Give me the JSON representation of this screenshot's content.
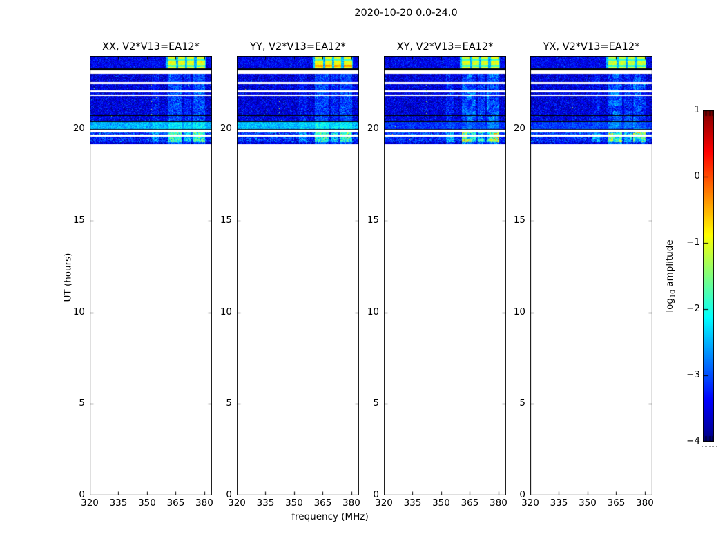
{
  "figure": {
    "title": "2020-10-20 0.0-24.0"
  },
  "colorbar": {
    "label_log": "log",
    "label_sub": "10",
    "label_rest": " amplitude",
    "vmin": -4,
    "vmax": 1,
    "ticks": [
      {
        "value": 1,
        "label": "1"
      },
      {
        "value": 0,
        "label": "0"
      },
      {
        "value": -1,
        "label": "−1"
      },
      {
        "value": -2,
        "label": "−2"
      },
      {
        "value": -3,
        "label": "−3"
      },
      {
        "value": -4,
        "label": "−4"
      }
    ]
  },
  "chart_data": {
    "type": "heatmap",
    "title": "2020-10-20 0.0-24.0",
    "date": "2020-10-20",
    "time_range_hours": [
      0.0,
      24.0
    ],
    "baseline": "V2*V13=EA12*",
    "polarizations": [
      "XX",
      "YY",
      "XY",
      "YX"
    ],
    "x": {
      "label": "frequency (MHz)",
      "range": [
        320,
        384
      ],
      "ticks": [
        320,
        335,
        350,
        365,
        380
      ]
    },
    "y": {
      "label": "UT (hours)",
      "range": [
        0,
        24
      ],
      "ticks": [
        0,
        5,
        10,
        15,
        20
      ]
    },
    "value_label": "log10 amplitude",
    "value_range": [
      -4,
      1
    ],
    "colormap": "jet",
    "panels": [
      {
        "title": "XX, V2*V13=EA12*",
        "pol": "XX",
        "seed": 101,
        "band20_mean": -2.5,
        "block_value": -1.0,
        "blob": false,
        "dot_freq": 352,
        "hot_row": null
      },
      {
        "title": "YY, V2*V13=EA12*",
        "pol": "YY",
        "seed": 202,
        "band20_mean": -2.45,
        "block_value": -0.95,
        "blob": false,
        "dot_freq": 342,
        "hot_row": {
          "h0": 23.4,
          "h1": 23.5,
          "value": -0.4
        }
      },
      {
        "title": "XY, V2*V13=EA12*",
        "pol": "XY",
        "seed": 303,
        "band20_mean": -3.15,
        "block_value": -1.05,
        "blob": true,
        "dot_freq": 342,
        "hot_row": null
      },
      {
        "title": "YX, V2*V13=EA12*",
        "pol": "YX",
        "seed": 404,
        "band20_mean": -3.1,
        "block_value": -1.15,
        "blob": true,
        "dot_freq": 342,
        "hot_row": null
      }
    ],
    "rows": [
      {
        "h0": 23.32,
        "h1": 24.01,
        "type": "topband",
        "mean": -3.45,
        "sd": 0.25
      },
      {
        "h0": 23.22,
        "h1": 23.32,
        "type": "sep"
      },
      {
        "h0": 23.02,
        "h1": 23.22,
        "type": "white"
      },
      {
        "h0": 22.55,
        "h1": 23.02,
        "type": "noise",
        "mean": -3.55,
        "sd": 0.3
      },
      {
        "h0": 22.45,
        "h1": 22.55,
        "type": "white"
      },
      {
        "h0": 22.12,
        "h1": 22.45,
        "type": "noise",
        "mean": -3.55,
        "sd": 0.3
      },
      {
        "h0": 22.02,
        "h1": 22.12,
        "type": "white"
      },
      {
        "h0": 21.88,
        "h1": 22.02,
        "type": "noise",
        "mean": -3.5,
        "sd": 0.3
      },
      {
        "h0": 21.8,
        "h1": 21.88,
        "type": "white"
      },
      {
        "h0": 20.78,
        "h1": 21.8,
        "type": "noise",
        "mean": -3.55,
        "sd": 0.3
      },
      {
        "h0": 20.72,
        "h1": 20.78,
        "type": "sep"
      },
      {
        "h0": 20.44,
        "h1": 20.72,
        "type": "noise",
        "mean": -3.5,
        "sd": 0.3
      },
      {
        "h0": 20.39,
        "h1": 20.44,
        "type": "sep"
      },
      {
        "h0": 20.02,
        "h1": 20.39,
        "type": "band20",
        "sd": 0.2
      },
      {
        "h0": 19.96,
        "h1": 20.02,
        "type": "sep"
      },
      {
        "h0": 19.82,
        "h1": 19.96,
        "type": "white"
      },
      {
        "h0": 19.7,
        "h1": 19.82,
        "type": "speckle",
        "mean": -3.1,
        "sd": 0.35
      },
      {
        "h0": 19.6,
        "h1": 19.7,
        "type": "white"
      },
      {
        "h0": 19.28,
        "h1": 19.6,
        "type": "speckle",
        "mean": -3.2,
        "sd": 0.35
      },
      {
        "h0": 19.17,
        "h1": 19.28,
        "type": "noise",
        "mean": -3.5,
        "sd": 0.3
      }
    ],
    "stripes": [
      {
        "f0": 352.5,
        "f1": 356.5,
        "boost": 0.22
      },
      {
        "f0": 361.0,
        "f1": 368.0,
        "boost": 0.5
      },
      {
        "f0": 369.0,
        "f1": 373.0,
        "boost": 0.32
      },
      {
        "f0": 374.0,
        "f1": 380.5,
        "boost": 0.5
      }
    ],
    "blocks": [
      {
        "f0": 360.8,
        "f1": 365.2
      },
      {
        "f0": 366.2,
        "f1": 369.9
      },
      {
        "f0": 370.9,
        "f1": 374.7
      },
      {
        "f0": 376.1,
        "f1": 380.3
      }
    ],
    "colors": {
      "separator_line": "#000510",
      "background": "#ffffff",
      "frame": "#000000"
    }
  }
}
